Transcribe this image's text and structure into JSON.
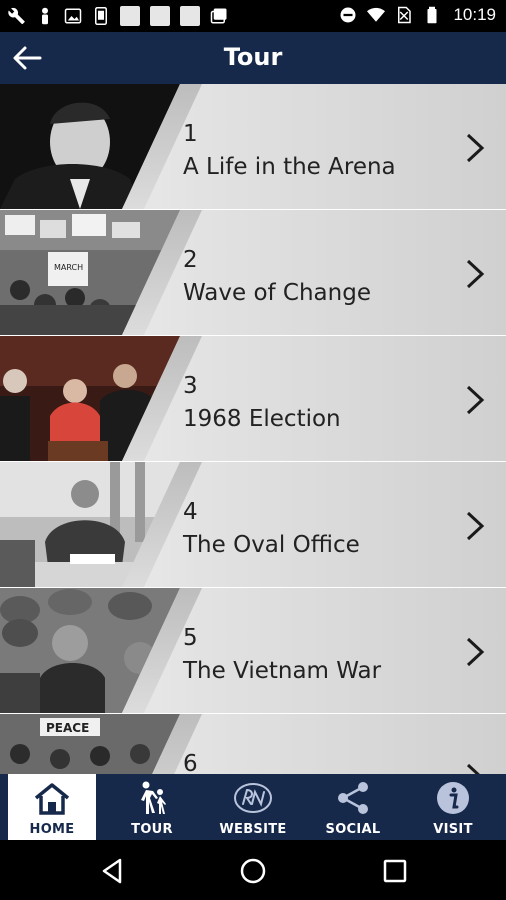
{
  "status_bar": {
    "time": "10:19",
    "icons": [
      "wrench-icon",
      "person-icon",
      "image-icon",
      "phone-icon",
      "square-icon",
      "square-icon",
      "square-icon",
      "photos-icon",
      "do-not-disturb-icon",
      "wifi-icon",
      "no-sim-icon",
      "battery-icon"
    ]
  },
  "header": {
    "title": "Tour",
    "back_icon": "back-arrow-icon"
  },
  "tour_items": [
    {
      "number": "1",
      "label": "A Life in the Arena"
    },
    {
      "number": "2",
      "label": "Wave of Change"
    },
    {
      "number": "3",
      "label": "1968 Election"
    },
    {
      "number": "4",
      "label": "The Oval Office"
    },
    {
      "number": "5",
      "label": "The Vietnam War"
    },
    {
      "number": "6",
      "label": ""
    }
  ],
  "photo_texts": {
    "sign_a": "MARCH",
    "sign_b": "PEACE"
  },
  "tabs": [
    {
      "label": "HOME",
      "icon": "home-icon",
      "active": true
    },
    {
      "label": "TOUR",
      "icon": "walking-people-icon",
      "active": false
    },
    {
      "label": "WEBSITE",
      "icon": "rn-logo-icon",
      "active": false
    },
    {
      "label": "SOCIAL",
      "icon": "share-icon",
      "active": false
    },
    {
      "label": "VISIT",
      "icon": "info-icon",
      "active": false
    }
  ],
  "colors": {
    "primary": "#17294b",
    "row_gradient_start": "#f3f3f3",
    "row_gradient_end": "#d0d0d0"
  },
  "android_nav": [
    "back-triangle-icon",
    "home-circle-icon",
    "recents-square-icon"
  ]
}
